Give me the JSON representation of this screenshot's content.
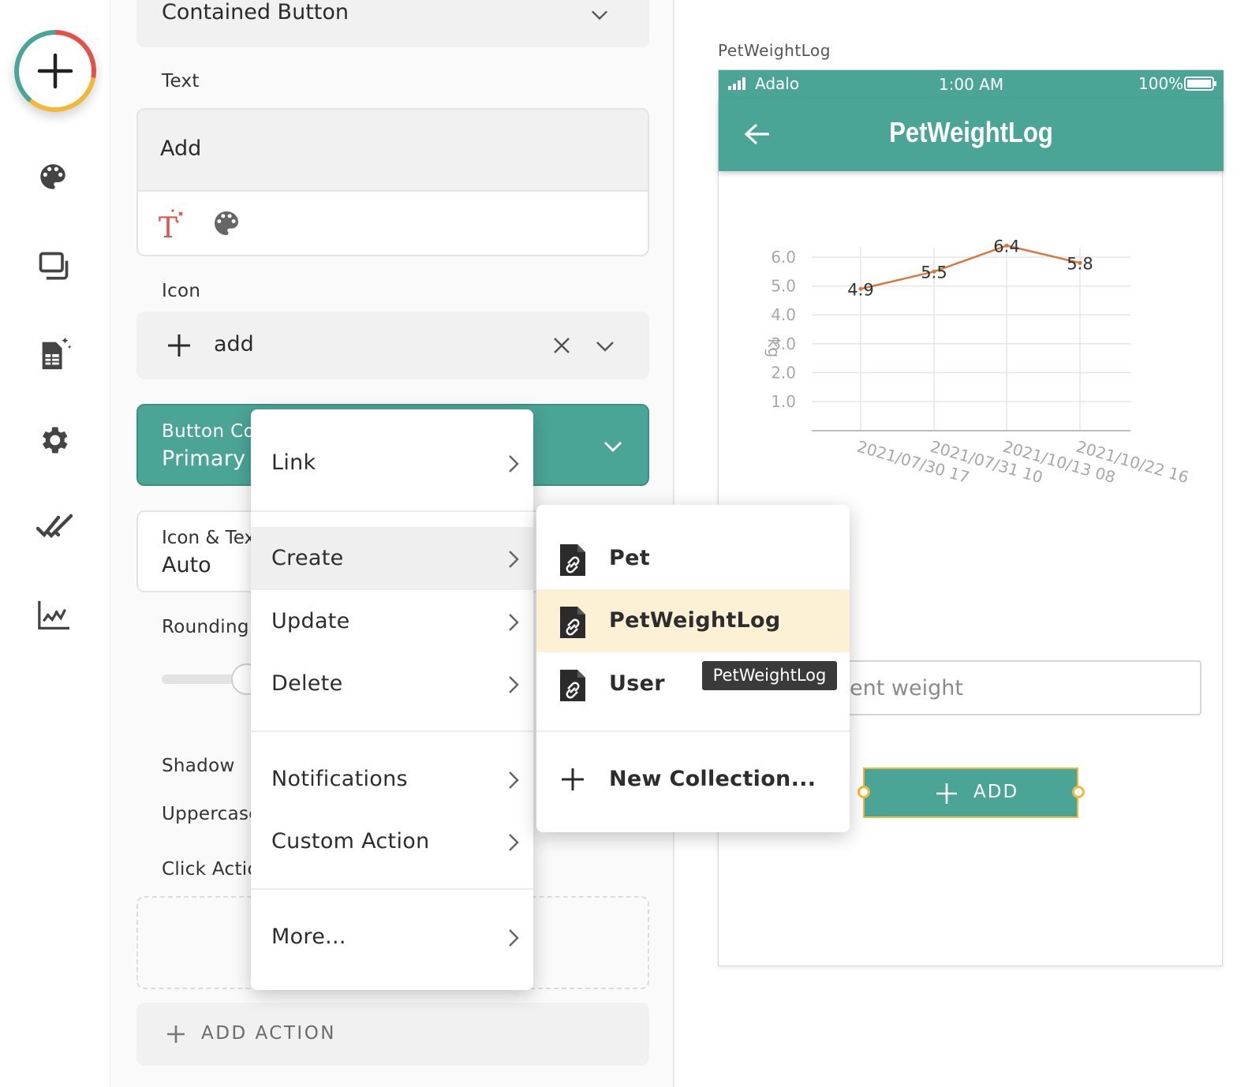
{
  "properties": {
    "component_type": "Contained Button",
    "text_label": "Text",
    "text_value": "Add",
    "icon_label": "Icon",
    "icon_value": "add",
    "button_color_label": "Button Co",
    "button_color_value": "Primary",
    "icon_text_label": "Icon & Tex",
    "icon_text_value": "Auto",
    "rounding_label": "Rounding",
    "shadow_label": "Shadow",
    "uppercase_label": "Uppercase",
    "click_action_label": "Click Actio",
    "add_action_label": "ADD ACTION",
    "accent_color": "#4aa596",
    "brand_colors": [
      "#e0524a",
      "#f0b93a",
      "#4aa596"
    ]
  },
  "rail": {
    "icons": [
      "add-icon",
      "palette-icon",
      "screens-icon",
      "database-icon",
      "gear-icon",
      "publish-check-icon",
      "analytics-icon"
    ]
  },
  "menu": {
    "items": [
      {
        "label": "Link"
      },
      {
        "label": "Create"
      },
      {
        "label": "Update"
      },
      {
        "label": "Delete"
      },
      {
        "label": "Notifications"
      },
      {
        "label": "Custom Action"
      },
      {
        "label": "More..."
      }
    ]
  },
  "submenu": {
    "items": [
      {
        "label": "Pet"
      },
      {
        "label": "PetWeightLog"
      },
      {
        "label": "User"
      }
    ],
    "new_collection": "New Collection...",
    "highlight_color": "#fdf1d5"
  },
  "tooltip": "PetWeightLog",
  "preview": {
    "screen_name": "PetWeightLog",
    "status": {
      "carrier": "Adalo",
      "time": "1:00 AM",
      "battery": "100%"
    },
    "app_title": "PetWeightLog",
    "input_placeholder_visible": "ent weight",
    "add_button_label": "ADD"
  },
  "chart_data": {
    "type": "line",
    "categories": [
      "2021/07/30 17",
      "2021/07/31 10",
      "2021/10/13 08",
      "2021/10/22 16"
    ],
    "series": [
      {
        "values": [
          4.9,
          5.5,
          6.4,
          5.8
        ]
      }
    ],
    "y_ticks": [
      "1.0",
      "2.0",
      "3.0",
      "4.0",
      "5.0",
      "6.0"
    ],
    "ylabel": "kg",
    "ylim": [
      0,
      6.0
    ],
    "line_color": "#d9773a",
    "grid": true
  }
}
